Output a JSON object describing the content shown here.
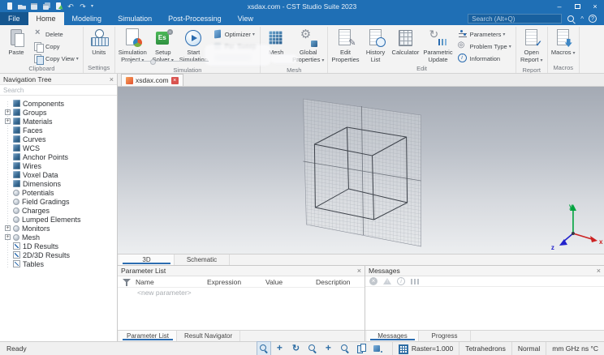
{
  "window": {
    "title": "xsdax.com - CST Studio Suite 2023",
    "search_placeholder": "Search (Alt+Q)"
  },
  "menu_tabs": [
    {
      "label": "File",
      "file": true
    },
    {
      "label": "Home",
      "active": true
    },
    {
      "label": "Modeling"
    },
    {
      "label": "Simulation"
    },
    {
      "label": "Post-Processing"
    },
    {
      "label": "View"
    }
  ],
  "ribbon": {
    "groups": [
      {
        "label": "Clipboard",
        "items": [
          {
            "type": "large",
            "icon": "paste-icon",
            "label": "Paste"
          },
          {
            "type": "stack",
            "items": [
              {
                "icon": "delete-icon",
                "label": "Delete"
              },
              {
                "icon": "copy-icon",
                "label": "Copy"
              },
              {
                "icon": "copy-view-icon",
                "label": "Copy View",
                "dropdown": true
              }
            ]
          }
        ]
      },
      {
        "label": "Settings",
        "items": [
          {
            "type": "large",
            "icon": "units-icon",
            "label": "Units"
          }
        ]
      },
      {
        "label": "Simulation",
        "items": [
          {
            "type": "large",
            "icon": "simulation-project-icon",
            "label": "Simulation\nProject",
            "dropdown": true
          },
          {
            "type": "large",
            "icon": "setup-solver-icon",
            "label": "Setup\nSolver",
            "dropdown": true
          },
          {
            "type": "large",
            "icon": "start-simulation-icon",
            "label": "Start\nSimulation"
          },
          {
            "type": "stack",
            "items": [
              {
                "icon": "optimizer-icon",
                "label": "Optimizer",
                "dropdown": true
              },
              {
                "icon": "par-sweep-icon",
                "label": "Par. Sweep",
                "blurred": true
              },
              {
                "label": "",
                "censored": true
              }
            ]
          }
        ]
      },
      {
        "label": "Mesh",
        "items": [
          {
            "type": "large",
            "icon": "mesh-view-icon",
            "label": "Mesh"
          },
          {
            "type": "large",
            "icon": "global-properties-icon",
            "label": "Global\nProperties",
            "dropdown": true
          }
        ]
      },
      {
        "label": "Edit",
        "items": [
          {
            "type": "large",
            "icon": "edit-properties-icon",
            "label": "Edit\nProperties"
          },
          {
            "type": "large",
            "icon": "history-list-icon",
            "label": "History\nList"
          },
          {
            "type": "large",
            "icon": "calculator-icon",
            "label": "Calculator"
          },
          {
            "type": "large",
            "icon": "parametric-update-icon",
            "label": "Parametric\nUpdate"
          },
          {
            "type": "stack",
            "items": [
              {
                "icon": "parameters-icon",
                "label": "Parameters",
                "dropdown": true
              },
              {
                "icon": "problem-type-icon",
                "label": "Problem Type",
                "dropdown": true
              },
              {
                "icon": "information-icon",
                "label": "Information"
              }
            ]
          }
        ]
      },
      {
        "label": "Report",
        "items": [
          {
            "type": "large",
            "icon": "open-report-icon",
            "label": "Open\nReport",
            "dropdown": true
          }
        ]
      },
      {
        "label": "Macros",
        "items": [
          {
            "type": "large",
            "icon": "macros-icon",
            "label": "Macros",
            "dropdown": true
          }
        ]
      }
    ]
  },
  "navigation_tree": {
    "title": "Navigation Tree",
    "search_placeholder": "Search",
    "items": [
      {
        "label": "Components",
        "icon": "cube"
      },
      {
        "label": "Groups",
        "icon": "cube",
        "expandable": true
      },
      {
        "label": "Materials",
        "icon": "cube",
        "expandable": true
      },
      {
        "label": "Faces",
        "icon": "cube"
      },
      {
        "label": "Curves",
        "icon": "cube"
      },
      {
        "label": "WCS",
        "icon": "cube"
      },
      {
        "label": "Anchor Points",
        "icon": "cube"
      },
      {
        "label": "Wires",
        "icon": "cube"
      },
      {
        "label": "Voxel Data",
        "icon": "cube"
      },
      {
        "label": "Dimensions",
        "icon": "cube"
      },
      {
        "label": "Potentials",
        "icon": "circle"
      },
      {
        "label": "Field Gradings",
        "icon": "circle"
      },
      {
        "label": "Charges",
        "icon": "circle"
      },
      {
        "label": "Lumped Elements",
        "icon": "circle"
      },
      {
        "label": "Monitors",
        "icon": "circle",
        "expandable": true
      },
      {
        "label": "Mesh",
        "icon": "circle",
        "expandable": true
      },
      {
        "label": "1D Results",
        "icon": "chart"
      },
      {
        "label": "2D/3D Results",
        "icon": "chart"
      },
      {
        "label": "Tables",
        "icon": "chart"
      }
    ]
  },
  "viewport": {
    "document_tab": {
      "label": "xsdax.com"
    },
    "tabs": [
      {
        "label": "3D",
        "active": true
      },
      {
        "label": "Schematic"
      }
    ],
    "axis_labels": {
      "x": "x",
      "y": "y",
      "z": "z"
    }
  },
  "parameter_list": {
    "title": "Parameter List",
    "columns": [
      "Name",
      "Expression",
      "Value",
      "Description"
    ],
    "rows": [
      {
        "name": "<new parameter>"
      }
    ],
    "tabs": [
      {
        "label": "Parameter List",
        "active": true
      },
      {
        "label": "Result Navigator"
      }
    ]
  },
  "messages": {
    "title": "Messages",
    "tabs": [
      {
        "label": "Messages",
        "active": true
      },
      {
        "label": "Progress"
      }
    ]
  },
  "status_bar": {
    "ready": "Ready",
    "raster": "Raster=1.000",
    "cells": [
      "Tetrahedrons",
      "Normal",
      "mm GHz ns °C"
    ]
  },
  "colors": {
    "titlebar": "#1f6fb5",
    "accent": "#2b6cb0",
    "axis_x": "#cc2222",
    "axis_y": "#00a33e",
    "axis_z": "#2222cc"
  }
}
